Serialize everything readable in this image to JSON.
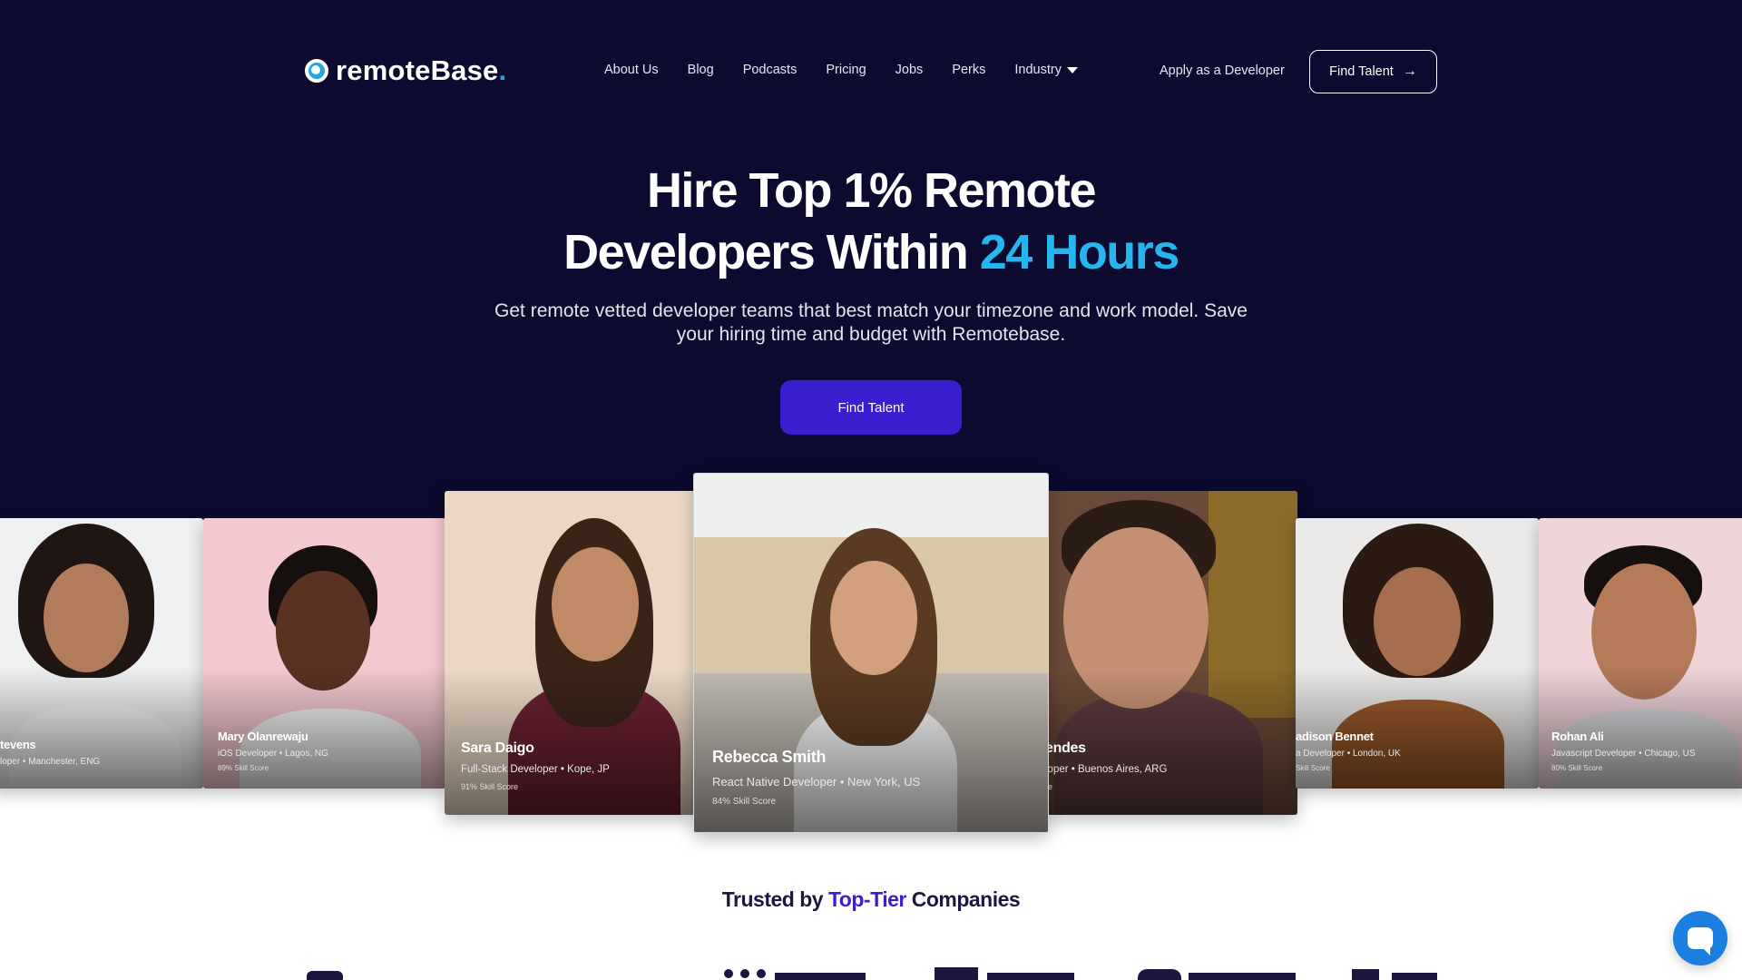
{
  "header": {
    "logo_text": "remoteBase",
    "logo_dot": ".",
    "nav": [
      {
        "label": "About Us"
      },
      {
        "label": "Blog"
      },
      {
        "label": "Podcasts"
      },
      {
        "label": "Pricing"
      },
      {
        "label": "Jobs"
      },
      {
        "label": "Perks"
      },
      {
        "label": "Industry",
        "dropdown": true
      }
    ],
    "apply_label": "Apply as a Developer",
    "find_talent_label": "Find Talent",
    "find_talent_icon": "arrow-right-icon"
  },
  "hero": {
    "headline_line1": "Hire Top 1% Remote",
    "headline_line2_prefix": "Developers Within ",
    "headline_line2_accent": "24 Hours",
    "subheadline": "Get remote vetted developer teams that best match your timezone and work model. Save your hiring time and budget with Remotebase.",
    "cta_label": "Find Talent"
  },
  "developers": [
    {
      "name": "tevens",
      "role": "loper • Manchester, ENG",
      "score": ""
    },
    {
      "name": "Mary Olanrewaju",
      "role": "iOS Developer • Lagos, NG",
      "score": "89% Skill Score"
    },
    {
      "name": "Sara Daigo",
      "role": "Full-Stack Developer • Kope, JP",
      "score": "91% Skill Score"
    },
    {
      "name": "Rebecca Smith",
      "role": "React Native Developer • New York, US",
      "score": "84% Skill Score"
    },
    {
      "name": "endes",
      "role": "loper • Buenos Aires, ARG",
      "score": "re"
    },
    {
      "name": "adison Bennet",
      "role": "a Developer • London, UK",
      "score": "Skill Score"
    },
    {
      "name": "Rohan Ali",
      "role": "Javascript Developer • Chicago, US",
      "score": "80% Skill Score"
    }
  ],
  "trusted": {
    "prefix": "Trusted by ",
    "accent": "Top-Tier",
    "suffix": " Companies"
  },
  "chat": {
    "icon": "chat-bubble-icon"
  },
  "colors": {
    "hero_bg": "#0c0a2e",
    "accent_cyan": "#25b5ef",
    "brand_purple": "#3a1fd0",
    "chat_blue": "#1a7fe0"
  }
}
